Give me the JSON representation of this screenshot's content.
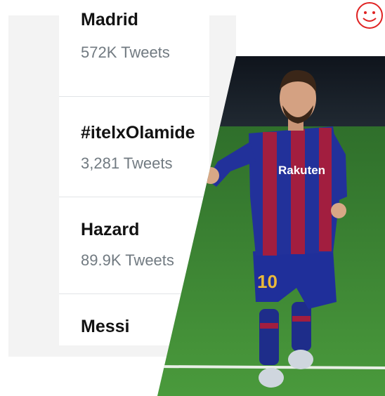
{
  "trends": [
    {
      "name": "Madrid",
      "count": "572K Tweets"
    },
    {
      "name": "#itelxOlamide",
      "count": "3,281 Tweets"
    },
    {
      "name": "Hazard",
      "count": "89.9K Tweets"
    },
    {
      "name": "Messi",
      "count": ""
    }
  ],
  "photo": {
    "shirt_text": "Rakuten",
    "number": "10"
  },
  "colors": {
    "grass": "#3f8a36",
    "stadium": "#151b24",
    "shirt_blue": "#22319a",
    "shirt_red": "#a21e3f",
    "smiley": "#e02323"
  }
}
